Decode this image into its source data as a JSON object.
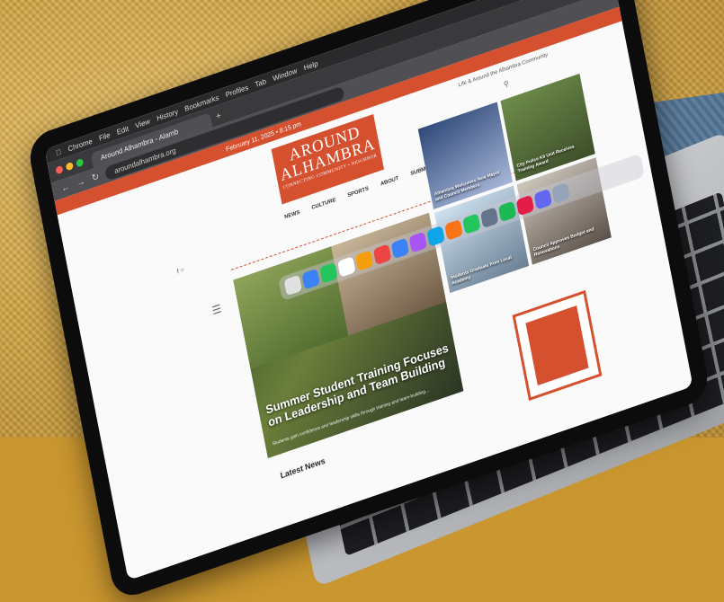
{
  "menubar": {
    "items": [
      "Chrome",
      "File",
      "Edit",
      "View",
      "History",
      "Bookmarks",
      "Profiles",
      "Tab",
      "Window",
      "Help"
    ]
  },
  "browser": {
    "tab_title": "Around Alhambra - Alamb",
    "url": "aroundalhambra.org",
    "window_dot_colors": [
      "#ff5f57",
      "#febc2e",
      "#28c840"
    ]
  },
  "site": {
    "topbar_text": "February 11, 2025 • 8:15 pm",
    "logo": {
      "line1": "AROUND",
      "line2": "ALHAMBRA",
      "line3": "CONNECTING COMMUNITY • NEIGHBOR"
    },
    "tagline": "Life & Around the Alhambra Community",
    "nav_menu": [
      "NEWS",
      "CULTURE",
      "SPORTS",
      "ABOUT",
      "SUBMIT"
    ],
    "feature": {
      "headline": "Summer Student Training Focuses on Leadership and Team Building",
      "subtext": "Students gain confidence and leadership skills through training and team-building..."
    },
    "tiles": [
      {
        "caption": "Alhambra Welcomes New Mayor and Council Members"
      },
      {
        "caption": "City Police K9 Unit Receives Training Award"
      },
      {
        "caption": "Students Graduate from Local Academy"
      },
      {
        "caption": "Council Approves Budget and Renovations"
      }
    ],
    "latest_news_label": "Latest News"
  },
  "colors": {
    "brand": "#d5502f",
    "blanket": "#c9962f"
  },
  "dock": {
    "app_colors": [
      "#e0e0e0",
      "#3b82f6",
      "#22c55e",
      "#ffffff",
      "#f59e0b",
      "#ef4444",
      "#3b82f6",
      "#a855f7",
      "#0ea5e9",
      "#f97316",
      "#22c55e",
      "#64748b",
      "#1db954",
      "#e11d48",
      "#6366f1",
      "#94a3b8"
    ]
  }
}
